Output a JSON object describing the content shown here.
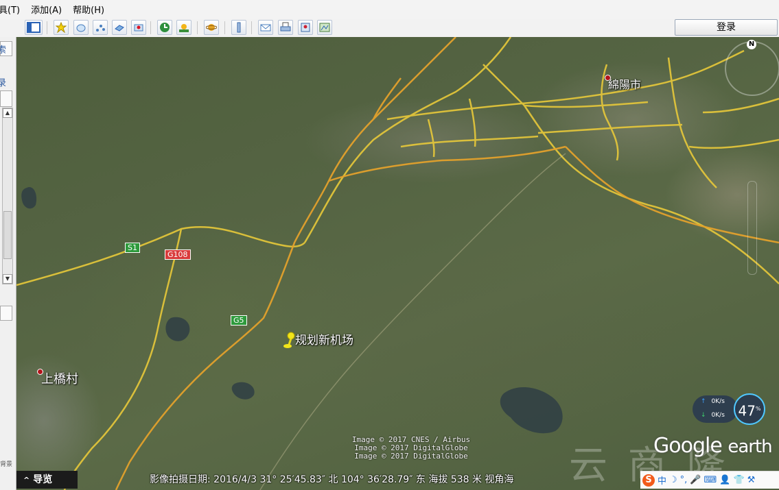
{
  "menu": {
    "items": [
      "具(T)",
      "添加(A)",
      "帮助(H)"
    ]
  },
  "toolbar": {
    "login_label": "登录",
    "buttons": [
      "sidebar-toggle-icon",
      "add-placemark-icon",
      "add-polygon-icon",
      "add-path-icon",
      "add-overlay-icon",
      "record-tour-icon",
      "historical-imagery-icon",
      "sunlight-icon",
      "switch-planet-icon",
      "ruler-icon",
      "email-icon",
      "print-icon",
      "save-image-icon",
      "view-in-maps-icon"
    ]
  },
  "sidebar": {
    "char1": "索",
    "char2": "录",
    "bottom_text": "背景"
  },
  "map": {
    "places": {
      "mianyang": "綿陽市",
      "shangqiao": "上橋村",
      "airport": "规划新机场"
    },
    "shields": {
      "s1": "S1",
      "g108": "G108",
      "g5": "G5"
    },
    "credits": [
      "Image © 2017 CNES / Airbus",
      "Image © 2017 DigitalGlobe",
      "Image © 2017 DigitalGlobe"
    ],
    "logo_google": "Google",
    "logo_earth": "earth",
    "compass_n": "N",
    "watermark": "云 商 隆"
  },
  "speed_widget": {
    "up": "0K/s",
    "down": "0K/s",
    "percent": "47",
    "unit": "%"
  },
  "status_bar": {
    "nav_label": "导览",
    "nav_arrow": "^",
    "info": "影像拍摄日期: 2016/4/3   31° 25′45.83″ 北 104° 36′28.79″ 东 海拔   538 米   视角海"
  },
  "ime": {
    "s": "S",
    "items": [
      "中",
      "☽",
      "°,",
      "🎤",
      "⌨",
      "👤",
      "👕",
      "⚒"
    ]
  },
  "colors": {
    "road": "#e8c23a",
    "highway": "#e59a2a",
    "status_bg": "#1b1b1b"
  }
}
